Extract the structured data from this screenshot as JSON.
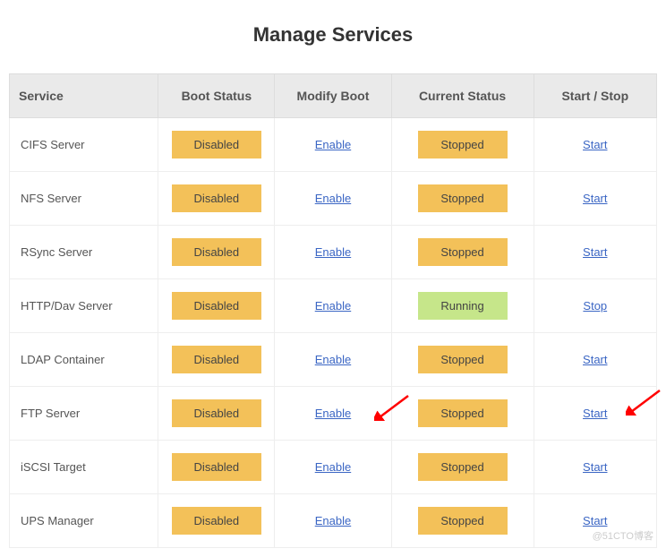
{
  "title": "Manage Services",
  "columns": {
    "service": "Service",
    "boot_status": "Boot Status",
    "modify_boot": "Modify Boot",
    "current_status": "Current Status",
    "start_stop": "Start / Stop"
  },
  "services": [
    {
      "name": "CIFS Server",
      "boot": "Disabled",
      "modify": "Enable",
      "status": "Stopped",
      "action": "Start"
    },
    {
      "name": "NFS Server",
      "boot": "Disabled",
      "modify": "Enable",
      "status": "Stopped",
      "action": "Start"
    },
    {
      "name": "RSync Server",
      "boot": "Disabled",
      "modify": "Enable",
      "status": "Stopped",
      "action": "Start"
    },
    {
      "name": "HTTP/Dav Server",
      "boot": "Disabled",
      "modify": "Enable",
      "status": "Running",
      "action": "Stop"
    },
    {
      "name": "LDAP Container",
      "boot": "Disabled",
      "modify": "Enable",
      "status": "Stopped",
      "action": "Start"
    },
    {
      "name": "FTP Server",
      "boot": "Disabled",
      "modify": "Enable",
      "status": "Stopped",
      "action": "Start"
    },
    {
      "name": "iSCSI Target",
      "boot": "Disabled",
      "modify": "Enable",
      "status": "Stopped",
      "action": "Start"
    },
    {
      "name": "UPS Manager",
      "boot": "Disabled",
      "modify": "Enable",
      "status": "Stopped",
      "action": "Start"
    }
  ],
  "watermark": "@51CTO博客"
}
